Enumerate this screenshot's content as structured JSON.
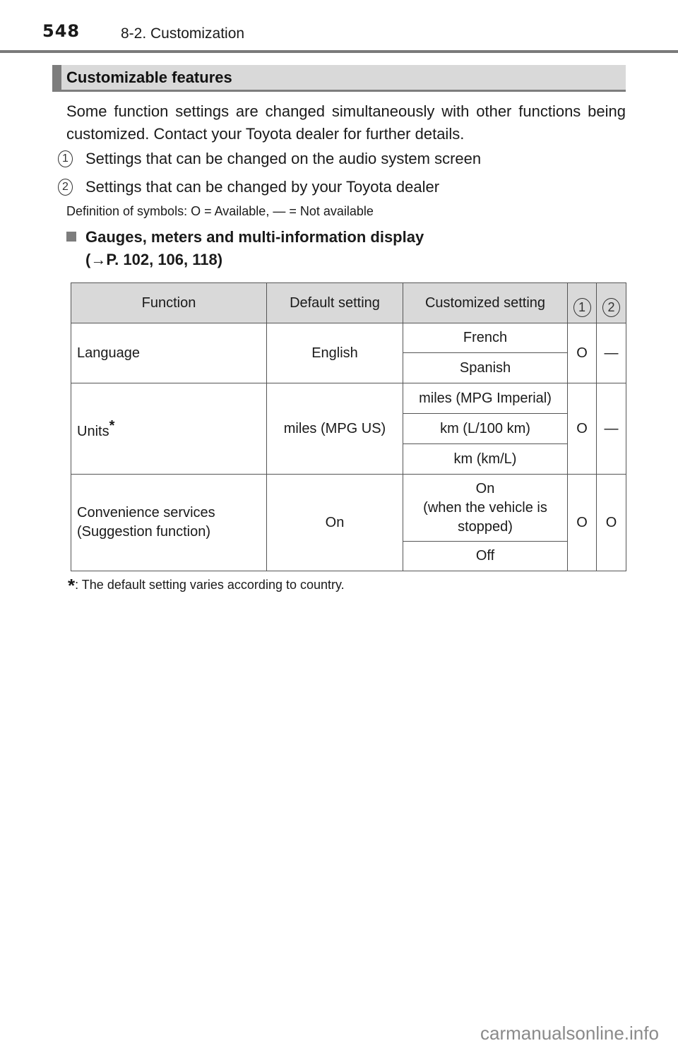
{
  "header": {
    "page_number": "548",
    "section": "8-2. Customization"
  },
  "section_bar": {
    "title": "Customizable features"
  },
  "intro": "Some function settings are changed simultaneously with other functions being customized. Contact your Toyota dealer for further details.",
  "legend": [
    {
      "num": "1",
      "text": "Settings that can be changed on the audio system screen"
    },
    {
      "num": "2",
      "text": "Settings that can be changed by your Toyota dealer"
    }
  ],
  "symbol_definition": "Definition of symbols: O = Available, — = Not available",
  "subheading": {
    "line1": "Gauges, meters and multi-information display",
    "line2": "(→P. 102, 106, 118)"
  },
  "table": {
    "headers": {
      "function": "Function",
      "default": "Default setting",
      "customized": "Customized setting",
      "col1": "1",
      "col2": "2"
    },
    "rows": [
      {
        "function": "Language",
        "function_marker": "",
        "default": "English",
        "options": [
          "French",
          "Spanish"
        ],
        "col1": "O",
        "col2": "—"
      },
      {
        "function": "Units",
        "function_marker": "*",
        "default": "miles (MPG US)",
        "options": [
          "miles (MPG Imperial)",
          "km (L/100 km)",
          "km (km/L)"
        ],
        "col1": "O",
        "col2": "—"
      },
      {
        "function": "Convenience services (Suggestion function)",
        "function_line1": "Convenience services",
        "function_line2": "(Suggestion function)",
        "function_marker": "",
        "default": "On",
        "options": [
          "On (when the vehicle is stopped)",
          "Off"
        ],
        "option_lines": [
          "On",
          "(when the vehicle is",
          "stopped)"
        ],
        "col1": "O",
        "col2": "O"
      }
    ]
  },
  "footnote": {
    "marker": "*",
    "text": ": The default setting varies according to country."
  },
  "watermark": "carmanualsonline.info"
}
